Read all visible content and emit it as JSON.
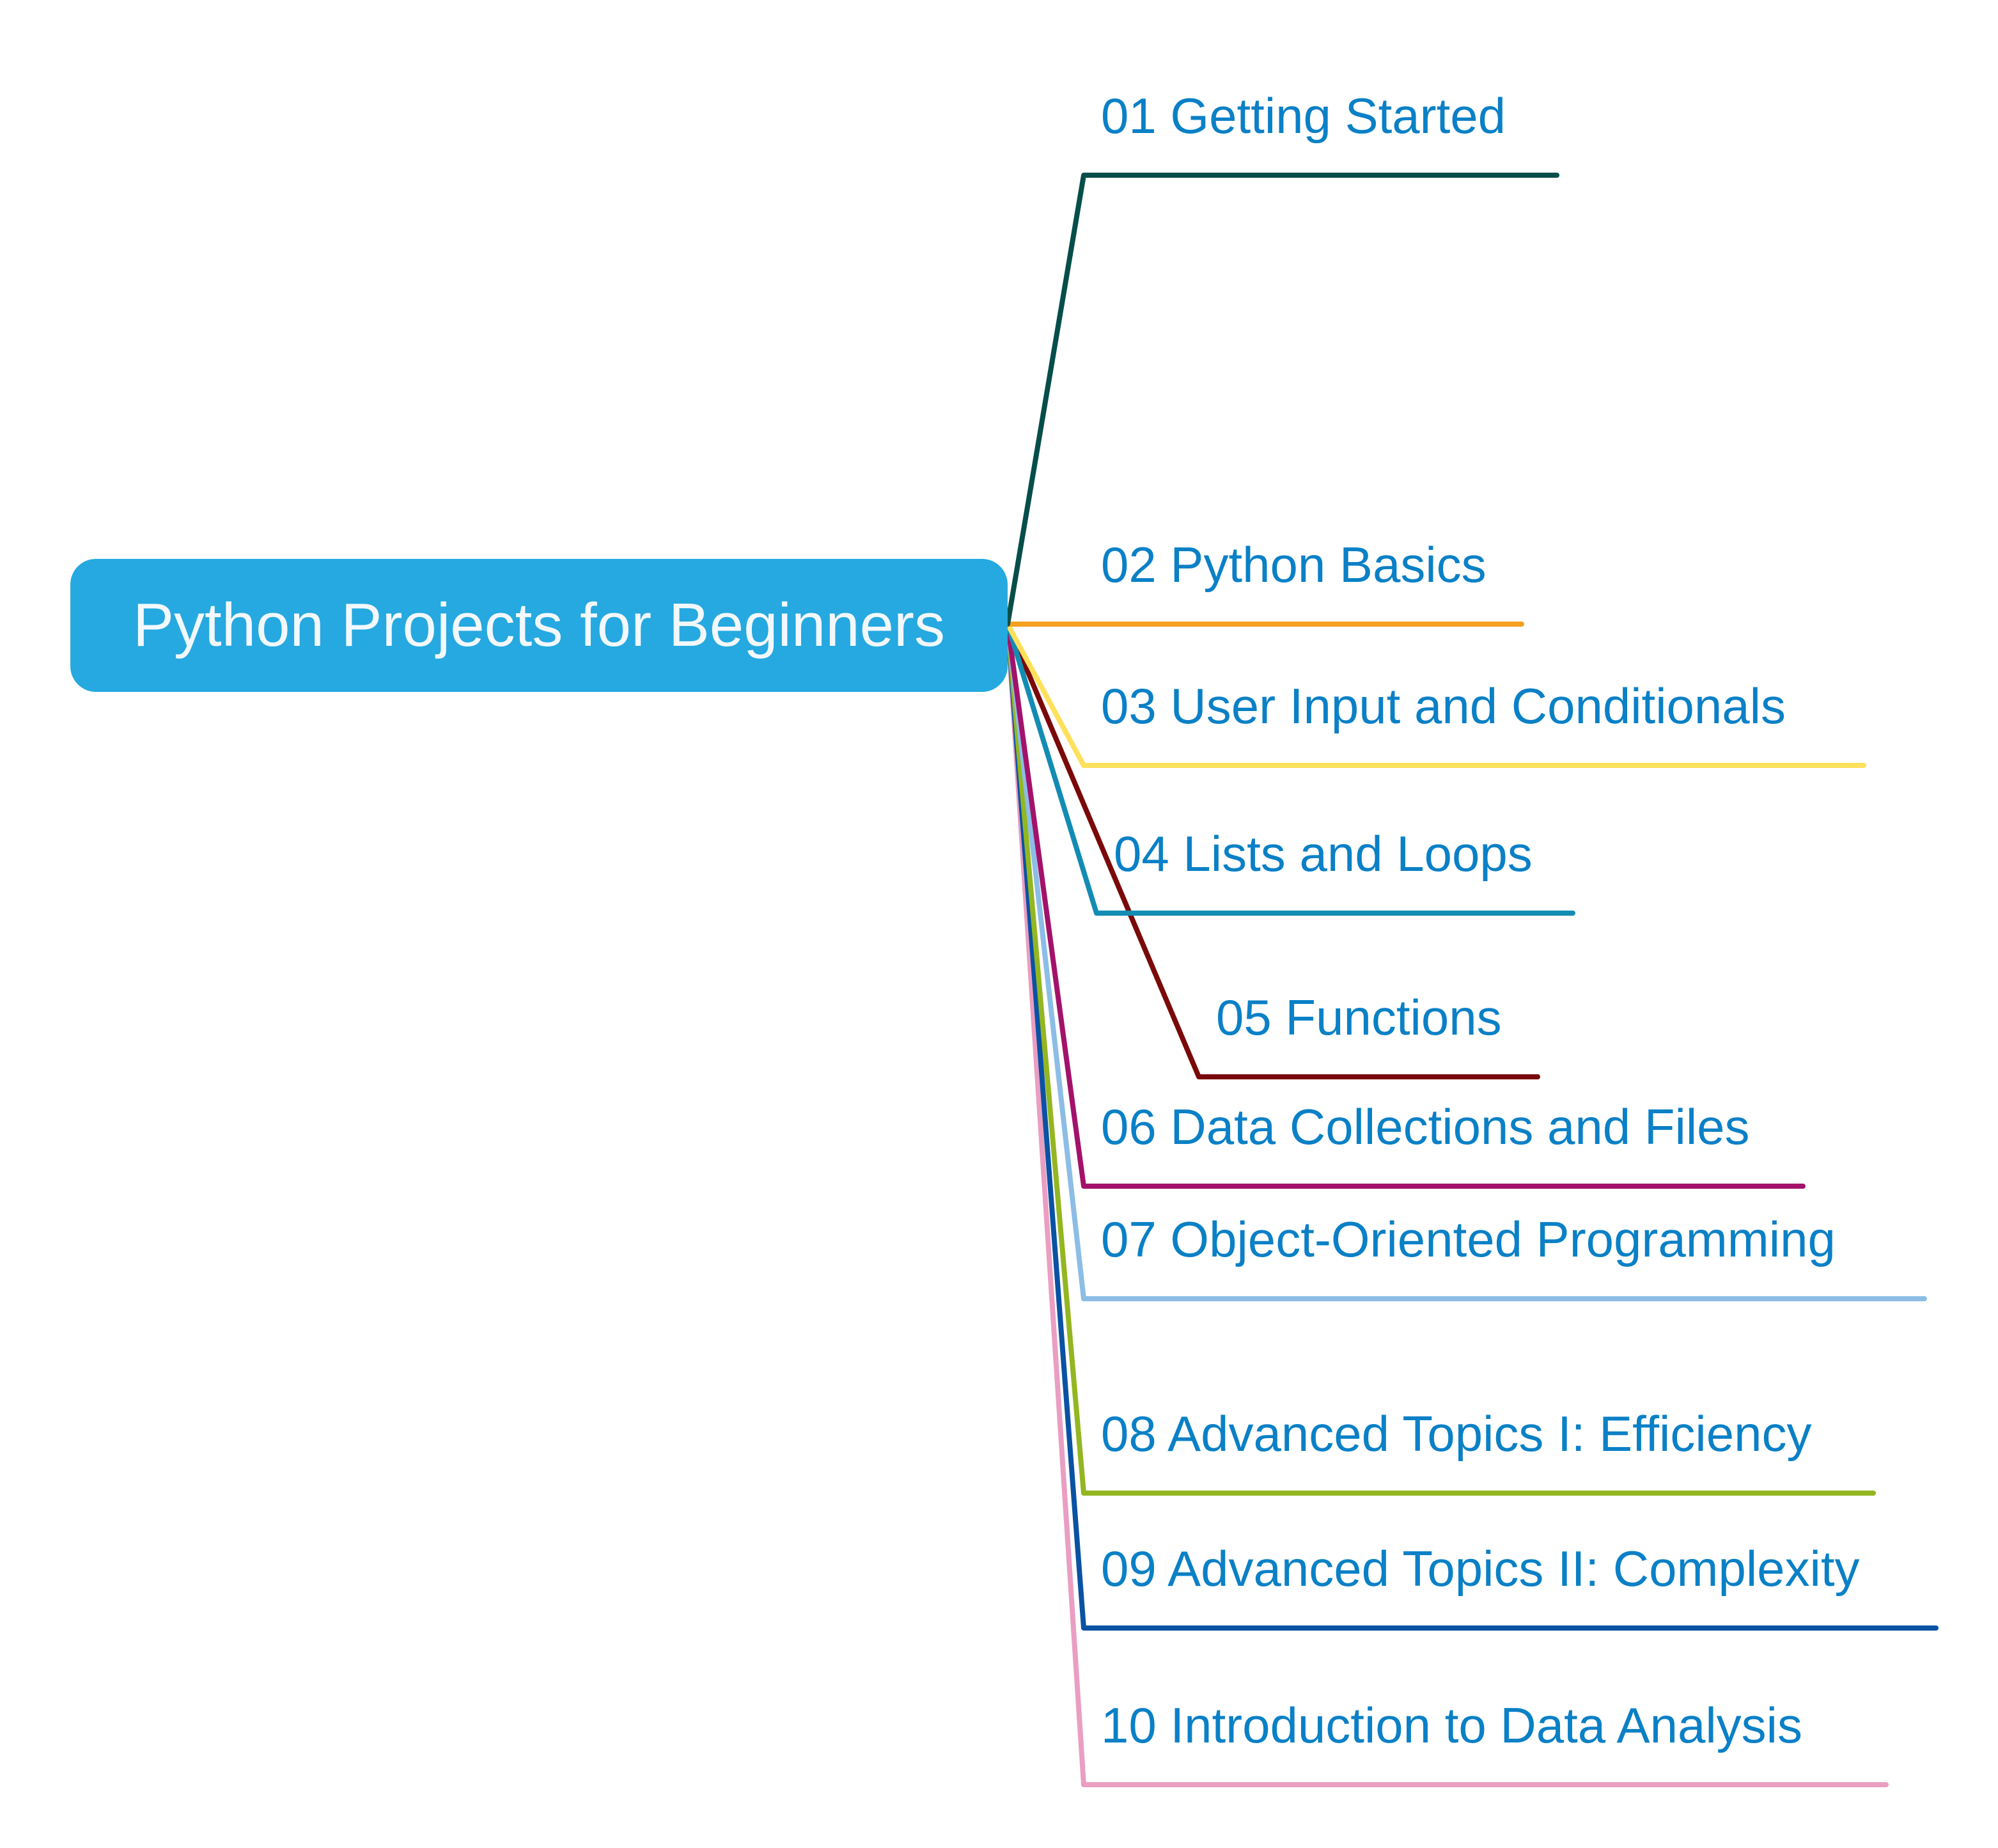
{
  "root": {
    "label": "Python Projects for Beginners",
    "color": "#25a9e0"
  },
  "branches": [
    {
      "label": "01 Getting Started",
      "color": "#064e49"
    },
    {
      "label": "02 Python Basics",
      "color": "#f5a01f"
    },
    {
      "label": "03 User Input and Conditionals",
      "color": "#ffe05c"
    },
    {
      "label": "04 Lists and Loops",
      "color": "#138cb4"
    },
    {
      "label": "05 Functions",
      "color": "#7a0a0a"
    },
    {
      "label": "06 Data Collections and Files",
      "color": "#a3126a"
    },
    {
      "label": "07 Object-Oriented Programming",
      "color": "#8cbde6"
    },
    {
      "label": "08 Advanced Topics I: Efficiency",
      "color": "#93b621"
    },
    {
      "label": "09 Advanced Topics II: Complexity",
      "color": "#0a52a3"
    },
    {
      "label": "10 Introduction to Data Analysis",
      "color": "#ea9ec2"
    }
  ],
  "label_color": "#0a80c6"
}
